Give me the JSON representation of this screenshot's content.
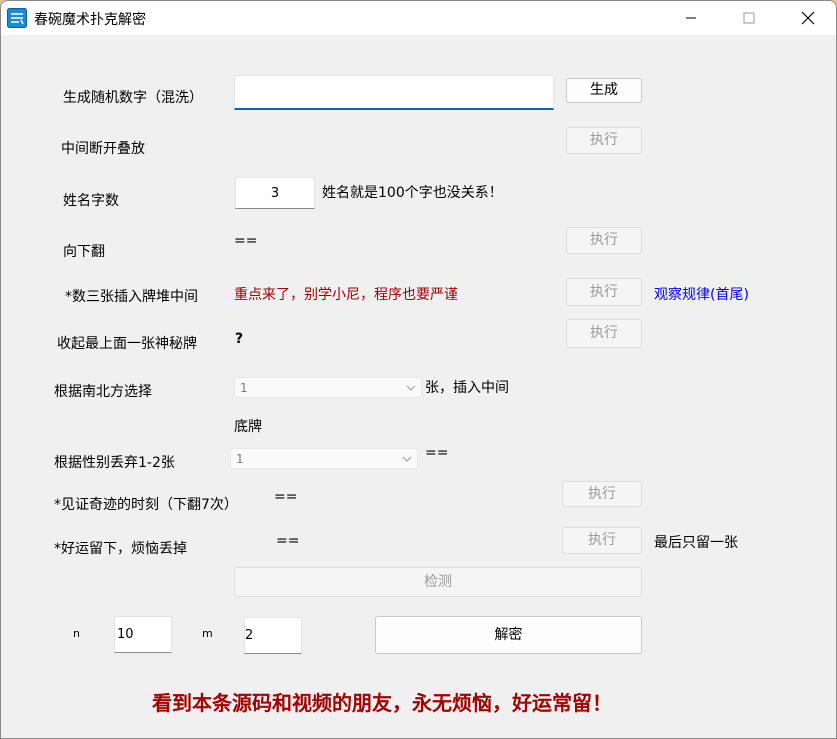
{
  "window": {
    "title": "春碗魔术扑克解密",
    "minimize_glyph": "—",
    "maximize_glyph": "☐",
    "close_glyph": "✕"
  },
  "row_shuffle": {
    "label": "生成随机数字（混洗）",
    "input_value": "",
    "button": "生成"
  },
  "row_split": {
    "label": "中间断开叠放",
    "button": "执行"
  },
  "row_name": {
    "label": "姓名字数",
    "input_value": "3",
    "note": "姓名就是100个字也没关系！"
  },
  "row_flip": {
    "label": "向下翻",
    "value": "==",
    "button": "执行"
  },
  "row_insert3": {
    "label": "*数三张插入牌堆中间",
    "note": "重点来了，别学小尼，程序也要严谨",
    "button": "执行",
    "link": "观察规律(首尾)"
  },
  "row_mystery": {
    "label": "收起最上面一张神秘牌",
    "value": "?",
    "button": "执行"
  },
  "row_direction": {
    "label": "根据南北方选择",
    "select_value": "1",
    "suffix": "张，插入中间"
  },
  "row_bottom": {
    "label": "底牌"
  },
  "row_gender": {
    "label": "根据性别丢弃1-2张",
    "select_value": "1",
    "value": "=="
  },
  "row_miracle": {
    "label": "*见证奇迹的时刻（下翻7次）",
    "value": "==",
    "button": "执行"
  },
  "row_luck": {
    "label": "*好运留下，烦恼丢掉",
    "value": "==",
    "button": "执行",
    "note": "最后只留一张"
  },
  "check_button": "检测",
  "params": {
    "n_label": "n",
    "n_value": "10",
    "m_label": "m",
    "m_value": "2"
  },
  "decrypt_button": "解密",
  "footer": "看到本条源码和视频的朋友，永无烦恼，好运常留！",
  "colors": {
    "accent": "#0067c0",
    "red_text": "#a00000",
    "link": "#0000ee"
  }
}
